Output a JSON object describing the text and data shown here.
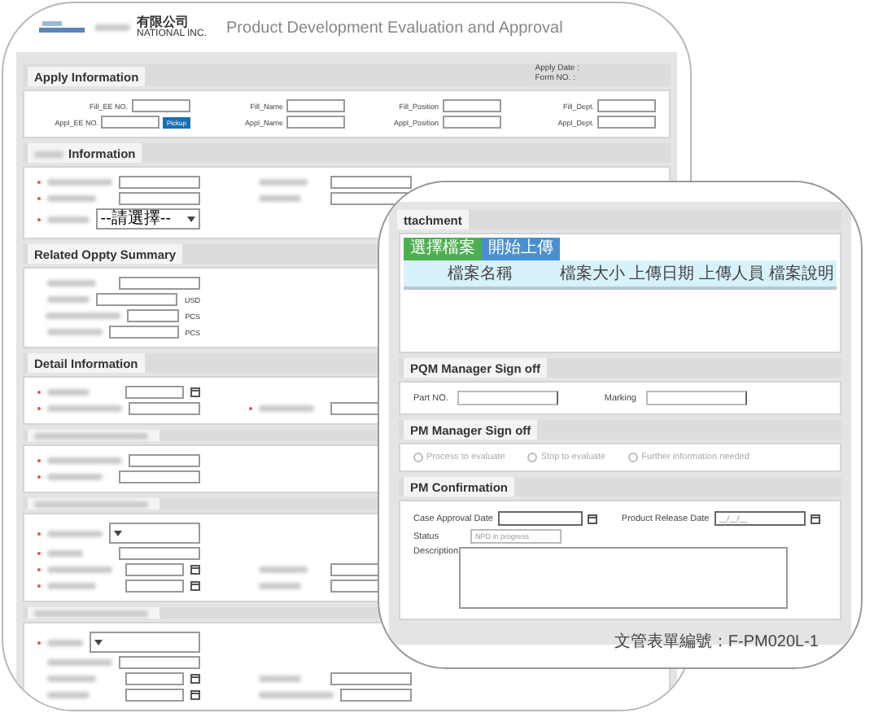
{
  "header": {
    "company_suffix": "有限公司",
    "company_sub": "NATIONAL INC.",
    "title": "Product Development Evaluation and Approval"
  },
  "apply": {
    "title": "Apply Information",
    "meta": [
      "Apply Date :",
      "Form NO. :"
    ],
    "rows": [
      [
        {
          "label": "Fill_EE NO."
        },
        {
          "label": "Fill_Name"
        },
        {
          "label": "Fill_Position"
        },
        {
          "label": "Fill_Dept."
        }
      ],
      [
        {
          "label": "Appl_EE NO.",
          "button": "Pickup"
        },
        {
          "label": "Appl_Name"
        },
        {
          "label": "Appl_Position"
        },
        {
          "label": "Appl_Dept."
        }
      ]
    ]
  },
  "sections": [
    {
      "title": "Information",
      "title_prefix_blurred": true,
      "rows": [
        [
          {
            "kind": "input",
            "required": true
          },
          {
            "kind": "input",
            "required": false
          }
        ],
        [
          {
            "kind": "input",
            "required": true
          },
          {
            "kind": "input",
            "required": false
          }
        ],
        [
          {
            "kind": "select",
            "required": true,
            "value": "--請選擇--"
          }
        ]
      ]
    },
    {
      "title": "Related Oppty Summary",
      "rows": [
        [
          {
            "kind": "input",
            "required": false
          }
        ],
        [
          {
            "kind": "input",
            "required": false,
            "unit": "USD"
          }
        ],
        [
          {
            "kind": "input",
            "required": false,
            "unit": "PCS"
          }
        ],
        [
          {
            "kind": "input",
            "required": false,
            "unit": "PCS"
          }
        ]
      ]
    },
    {
      "title": "Detail Information",
      "rows": [
        [
          {
            "kind": "date",
            "required": true
          }
        ],
        [
          {
            "kind": "input",
            "required": true
          },
          {
            "kind": "input",
            "required": true
          }
        ]
      ]
    },
    {
      "rows": [
        [
          {
            "kind": "input",
            "required": true
          }
        ],
        [
          {
            "kind": "input",
            "required": true
          }
        ]
      ]
    },
    {
      "rows": [
        [
          {
            "kind": "select",
            "required": true
          }
        ],
        [
          {
            "kind": "input",
            "required": true
          }
        ],
        [
          {
            "kind": "date",
            "required": true
          },
          {
            "kind": "input",
            "required": false
          }
        ],
        [
          {
            "kind": "date",
            "required": true
          },
          {
            "kind": "input",
            "required": false
          }
        ]
      ]
    },
    {
      "rows": [
        [
          {
            "kind": "select",
            "required": true
          }
        ],
        [
          {
            "kind": "input",
            "required": false
          }
        ],
        [
          {
            "kind": "date",
            "required": false
          },
          {
            "kind": "input",
            "required": false
          }
        ],
        [
          {
            "kind": "date",
            "required": false
          },
          {
            "kind": "input",
            "required": false
          }
        ]
      ]
    }
  ],
  "attachment": {
    "title": "ttachment",
    "buttons": [
      {
        "label": "選擇檔案",
        "kind": "pick"
      },
      {
        "label": "開始上傳",
        "kind": "upload"
      }
    ],
    "columns": [
      "檔案名稱",
      "檔案大小",
      "上傳日期",
      "上傳人員",
      "檔案說明"
    ]
  },
  "pqm": {
    "title": "PQM Manager Sign off",
    "fields": [
      "Part NO.",
      "Marking"
    ]
  },
  "pm_signoff": {
    "title": "PM Manager Sign off",
    "options": [
      {
        "label": "Process to evaluate",
        "selected": false,
        "disabled": true
      },
      {
        "label": "Stop to evaluate",
        "selected": false,
        "disabled": true
      },
      {
        "label": "Further information needed",
        "selected": false,
        "disabled": true
      }
    ]
  },
  "pm_confirm": {
    "title": "PM Confirmation",
    "case_date_label": "Case Approval Date",
    "release_date_label": "Product Release Date",
    "release_date_placeholder": "__/__/__",
    "status_label": "Status",
    "status_value": "NPD in progress",
    "status_disabled": true,
    "description_label": "Description"
  },
  "footer": "文管表單編號：F-PM020L-1"
}
